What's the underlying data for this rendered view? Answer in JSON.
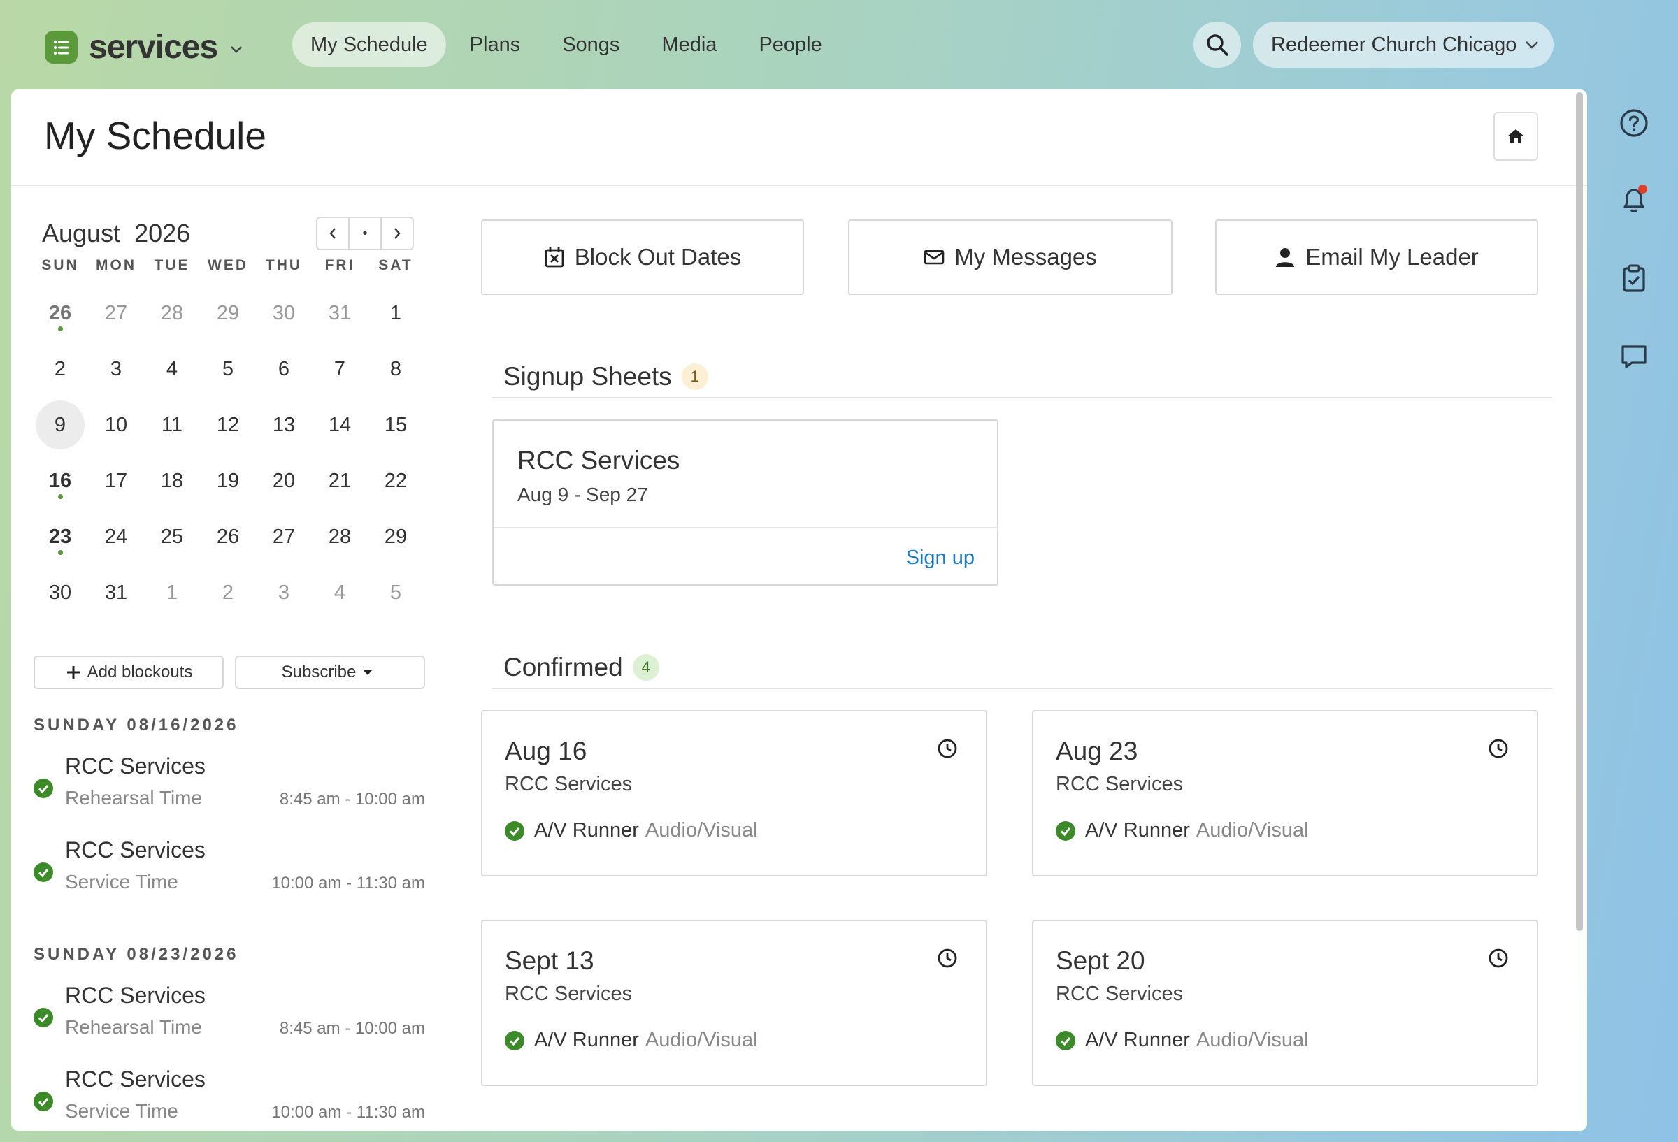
{
  "app": {
    "name": "services"
  },
  "nav": {
    "items": [
      {
        "label": "My Schedule",
        "active": true
      },
      {
        "label": "Plans",
        "active": false
      },
      {
        "label": "Songs",
        "active": false
      },
      {
        "label": "Media",
        "active": false
      },
      {
        "label": "People",
        "active": false
      }
    ]
  },
  "org": {
    "label": "Redeemer Church Chicago"
  },
  "page": {
    "title": "My Schedule"
  },
  "calendar": {
    "month_label": "August",
    "year_label": "2026",
    "today_dot": "•",
    "weekdays": [
      "SUN",
      "MON",
      "TUE",
      "WED",
      "THU",
      "FRI",
      "SAT"
    ],
    "weeks": [
      [
        "26",
        "27",
        "28",
        "29",
        "30",
        "31",
        "1"
      ],
      [
        "2",
        "3",
        "4",
        "5",
        "6",
        "7",
        "8"
      ],
      [
        "9",
        "10",
        "11",
        "12",
        "13",
        "14",
        "15"
      ],
      [
        "16",
        "17",
        "18",
        "19",
        "20",
        "21",
        "22"
      ],
      [
        "23",
        "24",
        "25",
        "26",
        "27",
        "28",
        "29"
      ],
      [
        "30",
        "31",
        "1",
        "2",
        "3",
        "4",
        "5"
      ]
    ]
  },
  "sidebar": {
    "add_blockouts": "Add blockouts",
    "subscribe": "Subscribe",
    "days": [
      {
        "header": "SUNDAY 08/16/2026",
        "items": [
          {
            "name": "RCC Services",
            "sub": "Rehearsal Time",
            "time": "8:45 am - 10:00 am"
          },
          {
            "name": "RCC Services",
            "sub": "Service Time",
            "time": "10:00 am - 11:30 am"
          }
        ]
      },
      {
        "header": "SUNDAY 08/23/2026",
        "items": [
          {
            "name": "RCC Services",
            "sub": "Rehearsal Time",
            "time": "8:45 am - 10:00 am"
          },
          {
            "name": "RCC Services",
            "sub": "Service Time",
            "time": "10:00 am - 11:30 am"
          }
        ]
      }
    ]
  },
  "actions": {
    "block_out": "Block Out Dates",
    "messages": "My Messages",
    "email_leader": "Email My Leader"
  },
  "signup": {
    "heading": "Signup Sheets",
    "count": "1",
    "card": {
      "title": "RCC Services",
      "dates": "Aug 9 - Sep 27",
      "link": "Sign up"
    }
  },
  "confirmed": {
    "heading": "Confirmed",
    "count": "4",
    "cards": [
      {
        "date": "Aug 16",
        "service": "RCC Services",
        "role": "A/V Runner",
        "team": "Audio/Visual"
      },
      {
        "date": "Aug 23",
        "service": "RCC Services",
        "role": "A/V Runner",
        "team": "Audio/Visual"
      },
      {
        "date": "Sept 13",
        "service": "RCC Services",
        "role": "A/V Runner",
        "team": "Audio/Visual"
      },
      {
        "date": "Sept 20",
        "service": "RCC Services",
        "role": "A/V Runner",
        "team": "Audio/Visual"
      }
    ]
  },
  "rail": {
    "icons": [
      "help-icon",
      "notification-bell-icon",
      "clipboard-check-icon",
      "chat-icon"
    ]
  },
  "colors": {
    "brand_green": "#5a9a3b",
    "link_blue": "#1d79c5",
    "notification_red": "#e0402a"
  }
}
